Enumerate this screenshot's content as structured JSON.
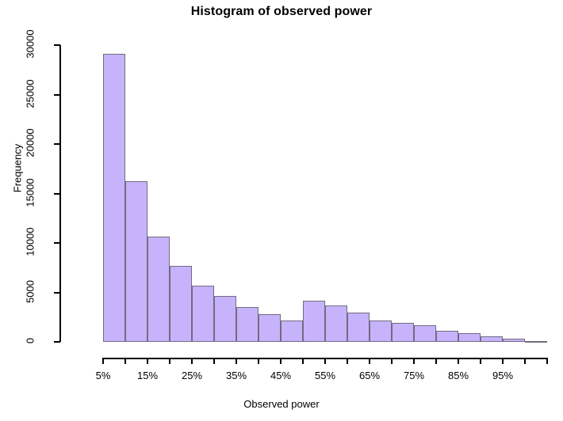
{
  "chart_data": {
    "type": "bar",
    "title": "Histogram of observed power",
    "xlabel": "Observed power",
    "ylabel": "Frequency",
    "grid": false,
    "legend": null,
    "bin_width_percent": 5,
    "xlim": [
      5,
      105
    ],
    "ylim": [
      0,
      30000
    ],
    "bar_fill_color": "#c6b3fc",
    "bar_border_color": "#726b80",
    "categories": [
      "5%-10%",
      "10%-15%",
      "15%-20%",
      "20%-25%",
      "25%-30%",
      "30%-35%",
      "35%-40%",
      "40%-45%",
      "45%-50%",
      "50%-55%",
      "55%-60%",
      "60%-65%",
      "65%-70%",
      "70%-75%",
      "75%-80%",
      "80%-85%",
      "85%-90%",
      "90%-95%",
      "95%-100%",
      "100%-105%"
    ],
    "bin_starts": [
      5,
      10,
      15,
      20,
      25,
      30,
      35,
      40,
      45,
      50,
      55,
      60,
      65,
      70,
      75,
      80,
      85,
      90,
      95,
      100
    ],
    "values": [
      29100,
      16250,
      10650,
      7650,
      5700,
      4650,
      3500,
      2800,
      2200,
      4150,
      3700,
      3000,
      2200,
      1900,
      1650,
      1150,
      900,
      600,
      350,
      100
    ],
    "y_ticks": [
      0,
      5000,
      10000,
      15000,
      20000,
      25000,
      30000
    ],
    "y_tick_labels": [
      "0",
      "5000",
      "10000",
      "15000",
      "20000",
      "25000",
      "30000"
    ],
    "x_ticks": [
      5,
      10,
      15,
      20,
      25,
      30,
      35,
      40,
      45,
      50,
      55,
      60,
      65,
      70,
      75,
      80,
      85,
      90,
      95,
      100,
      105
    ],
    "x_tick_labels": [
      "5%",
      "",
      "15%",
      "",
      "25%",
      "",
      "35%",
      "",
      "45%",
      "",
      "55%",
      "",
      "65%",
      "",
      "75%",
      "",
      "85%",
      "",
      "95%",
      "",
      ""
    ]
  }
}
